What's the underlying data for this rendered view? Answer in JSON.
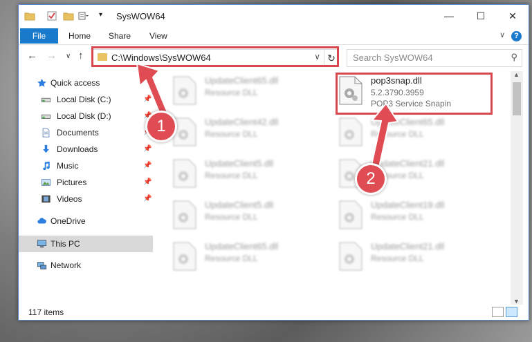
{
  "window": {
    "title": "SysWOW64",
    "minimize": "—",
    "maximize": "☐",
    "close": "✕"
  },
  "ribbon": {
    "file": "File",
    "tabs": [
      "Home",
      "Share",
      "View"
    ],
    "help": "?",
    "collapse": "∨"
  },
  "nav": {
    "back": "←",
    "forward": "→",
    "recent": "∨",
    "up": "↑",
    "address": "C:\\Windows\\SysWOW64",
    "address_drop": "∨",
    "refresh": "↻",
    "search_placeholder": "Search SysWOW64",
    "search_icon": "⚲"
  },
  "sidebar": {
    "items": [
      {
        "label": "Quick access",
        "icon": "star-icon",
        "pinned": false
      },
      {
        "label": "Local Disk (C:)",
        "icon": "drive-icon",
        "pinned": true
      },
      {
        "label": "Local Disk (D:)",
        "icon": "drive-icon",
        "pinned": true
      },
      {
        "label": "Documents",
        "icon": "documents-icon",
        "pinned": true
      },
      {
        "label": "Downloads",
        "icon": "download-icon",
        "pinned": true
      },
      {
        "label": "Music",
        "icon": "music-icon",
        "pinned": true
      },
      {
        "label": "Pictures",
        "icon": "pictures-icon",
        "pinned": true
      },
      {
        "label": "Videos",
        "icon": "videos-icon",
        "pinned": true
      },
      {
        "label": "OneDrive",
        "icon": "cloud-icon",
        "pinned": false
      },
      {
        "label": "This PC",
        "icon": "computer-icon",
        "pinned": false
      },
      {
        "label": "Network",
        "icon": "network-icon",
        "pinned": false
      }
    ],
    "pin_glyph": "📌"
  },
  "files": {
    "left": [
      {
        "name": "UpdateClient65.dll",
        "type": "Resource DLL"
      },
      {
        "name": "UpdateClient42.dll",
        "type": "Resource DLL"
      },
      {
        "name": "UpdateClient5.dll",
        "type": "Resource DLL"
      },
      {
        "name": "UpdateClient5.dll",
        "type": "Resource DLL"
      },
      {
        "name": "UpdateClient65.dll",
        "type": "Resource DLL"
      }
    ],
    "highlighted": {
      "name": "pop3snap.dll",
      "version": "5.2.3790.3959",
      "description": "POP3 Service Snapin"
    },
    "right": [
      {
        "name": "UpdateClient65.dll",
        "type": "Resource DLL"
      },
      {
        "name": "UpdateClient21.dll",
        "type": "Resource DLL"
      },
      {
        "name": "UpdateClient19.dll",
        "type": "Resource DLL"
      },
      {
        "name": "UpdateClient21.dll",
        "type": "Resource DLL"
      }
    ]
  },
  "status": {
    "count": "117 items"
  },
  "annotations": {
    "step1": "1",
    "step2": "2"
  },
  "colors": {
    "accent": "#1979ca",
    "annotation": "#d9474f",
    "selection": "#d9d9d9"
  }
}
